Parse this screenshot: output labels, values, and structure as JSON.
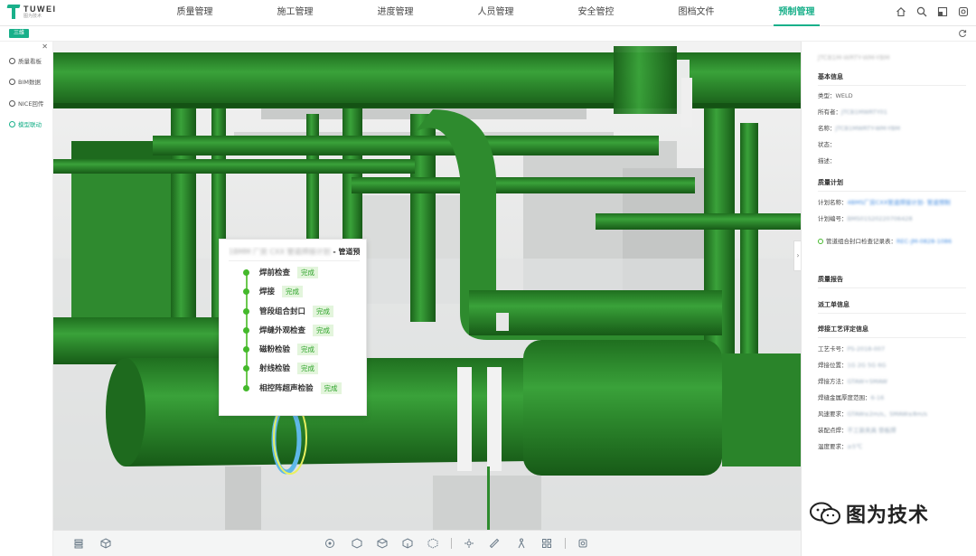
{
  "brand": {
    "name": "TUWEI",
    "subtitle": "图为技术"
  },
  "nav": {
    "items": [
      {
        "label": "质量管理"
      },
      {
        "label": "施工管理"
      },
      {
        "label": "进度管理"
      },
      {
        "label": "人员管理"
      },
      {
        "label": "安全管控"
      },
      {
        "label": "图档文件"
      },
      {
        "label": "预制管理"
      }
    ],
    "active_index": 6
  },
  "subbar": {
    "view_tag": "三维"
  },
  "left_menu": {
    "items": [
      {
        "label": "质量看板"
      },
      {
        "label": "BIM数据"
      },
      {
        "label": "NICE回传"
      },
      {
        "label": "模型联动"
      }
    ],
    "active_index": 3
  },
  "popup": {
    "title_blurred": "1BMM 厂房 CXX 管道焊接计划",
    "title_suffix": " - 管道预制",
    "steps": [
      {
        "name": "焊前检查",
        "status": "完成"
      },
      {
        "name": "焊接",
        "status": "完成"
      },
      {
        "name": "管段组合封口",
        "status": "完成"
      },
      {
        "name": "焊缝外观检查",
        "status": "完成"
      },
      {
        "name": "磁粉检验",
        "status": "完成"
      },
      {
        "name": "射线检验",
        "status": "完成"
      },
      {
        "name": "相控阵超声检验",
        "status": "完成"
      }
    ]
  },
  "right_panel": {
    "header_blurred": "JTCB1M-WRTY-WM-YBM",
    "sections": {
      "basic": "基本信息",
      "plan": "质量计划",
      "report": "质量报告",
      "dispatch": "派工单信息",
      "weld_proc": "焊接工艺评定信息"
    },
    "basic": {
      "type_label": "类型：",
      "type_value": "WELD",
      "owner_label": "所有者：",
      "owner_value": "JTCB1MWRTY01",
      "name_label": "名称：",
      "name_value": "JTCB1MWRTY-WM-YBM",
      "status_label": "状态：",
      "desc_label": "描述："
    },
    "plan": {
      "plan_name_label": "计划名称：",
      "plan_name_value": "4BMS厂房CXX管道焊接计划",
      "plan_name_suffix": "- 管道预制",
      "plan_no_label": "计划编号：",
      "plan_no_value": "BMS01S20220706428",
      "record_label": "管道组合封口检查记录表：",
      "record_value": "REC-JM-0828-1086"
    },
    "weld": {
      "card_label": "工艺卡号：",
      "card_value": "PS-2018-007",
      "position_label": "焊接位置：",
      "position_value": "1G 2G 5G 6G",
      "method_label": "焊接方法：",
      "method_value": "GTAW+SMAW",
      "thickness_label": "焊缝金属厚度范围：",
      "thickness_value": "6-16",
      "gas_label": "风速要求：",
      "gas_value": "GTAW≤2m/s，SMAW≤8m/s",
      "assembly_label": "装配点焊：",
      "assembly_value": "不工装夹具 垫板焊",
      "temp_label": "温度要求：",
      "temp_value": "≥5℃"
    }
  },
  "watermark": {
    "text": "图为技术"
  },
  "colors": {
    "accent": "#19b08a",
    "pipe_green": "#2e8b2e",
    "step_green": "#44b92b"
  }
}
